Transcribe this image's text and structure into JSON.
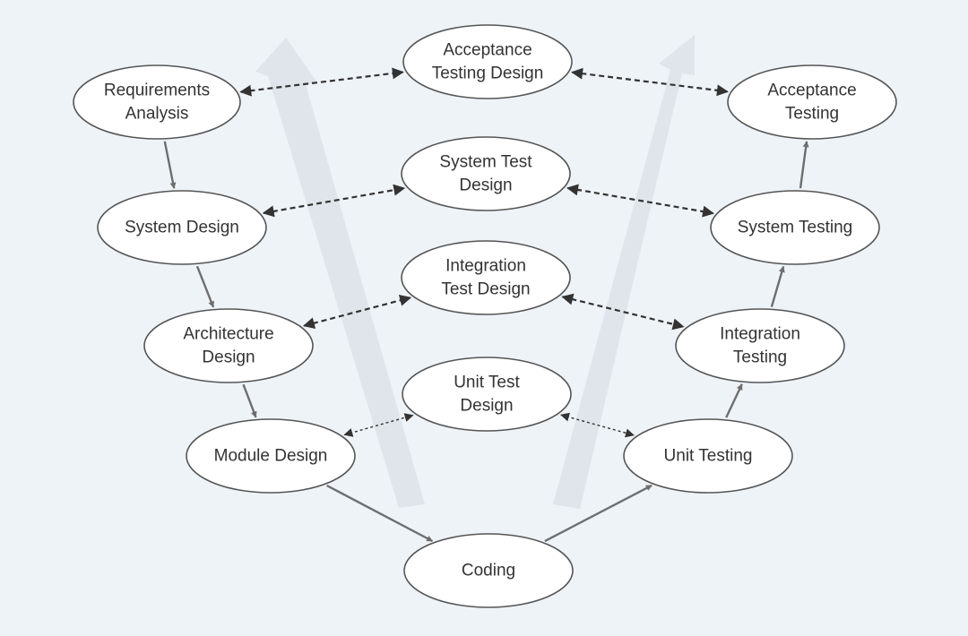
{
  "diagram": {
    "colors": {
      "background": "#eef3f8",
      "node_fill": "#ffffff",
      "node_stroke": "#555555",
      "text": "#333333",
      "flow_arrow": "#6e6e6e",
      "link_arrow": "#333333",
      "big_arrow": "#dfe5ea"
    },
    "nodes": [
      {
        "id": "requirements-analysis",
        "lines": [
          "Requirements",
          "Analysis"
        ]
      },
      {
        "id": "system-design",
        "lines": [
          "System Design"
        ]
      },
      {
        "id": "architecture-design",
        "lines": [
          "Architecture",
          "Design"
        ]
      },
      {
        "id": "module-design",
        "lines": [
          "Module Design"
        ]
      },
      {
        "id": "coding",
        "lines": [
          "Coding"
        ]
      },
      {
        "id": "unit-testing",
        "lines": [
          "Unit Testing"
        ]
      },
      {
        "id": "integration-testing",
        "lines": [
          "Integration",
          "Testing"
        ]
      },
      {
        "id": "system-testing",
        "lines": [
          "System Testing"
        ]
      },
      {
        "id": "acceptance-testing",
        "lines": [
          "Acceptance",
          "Testing"
        ]
      },
      {
        "id": "acceptance-testing-design",
        "lines": [
          "Acceptance",
          "Testing Design"
        ]
      },
      {
        "id": "system-test-design",
        "lines": [
          "System Test",
          "Design"
        ]
      },
      {
        "id": "integration-test-design",
        "lines": [
          "Integration",
          "Test Design"
        ]
      },
      {
        "id": "unit-test-design",
        "lines": [
          "Unit Test",
          "Design"
        ]
      }
    ],
    "flow_edges": [
      {
        "from": "requirements-analysis",
        "to": "system-design"
      },
      {
        "from": "system-design",
        "to": "architecture-design"
      },
      {
        "from": "architecture-design",
        "to": "module-design"
      },
      {
        "from": "module-design",
        "to": "coding"
      },
      {
        "from": "coding",
        "to": "unit-testing"
      },
      {
        "from": "unit-testing",
        "to": "integration-testing"
      },
      {
        "from": "integration-testing",
        "to": "system-testing"
      },
      {
        "from": "system-testing",
        "to": "acceptance-testing"
      }
    ],
    "link_edges": [
      {
        "from": "requirements-analysis",
        "to": "acceptance-testing-design",
        "style": "bidirectional-dashed"
      },
      {
        "from": "acceptance-testing-design",
        "to": "acceptance-testing",
        "style": "bidirectional-dashed"
      },
      {
        "from": "system-design",
        "to": "system-test-design",
        "style": "bidirectional-dashed"
      },
      {
        "from": "system-test-design",
        "to": "system-testing",
        "style": "bidirectional-dashed"
      },
      {
        "from": "architecture-design",
        "to": "integration-test-design",
        "style": "bidirectional-dashed"
      },
      {
        "from": "integration-test-design",
        "to": "integration-testing",
        "style": "bidirectional-dashed"
      },
      {
        "from": "module-design",
        "to": "unit-test-design",
        "style": "bidirectional-dotted"
      },
      {
        "from": "unit-test-design",
        "to": "unit-testing",
        "style": "bidirectional-dotted"
      }
    ]
  }
}
